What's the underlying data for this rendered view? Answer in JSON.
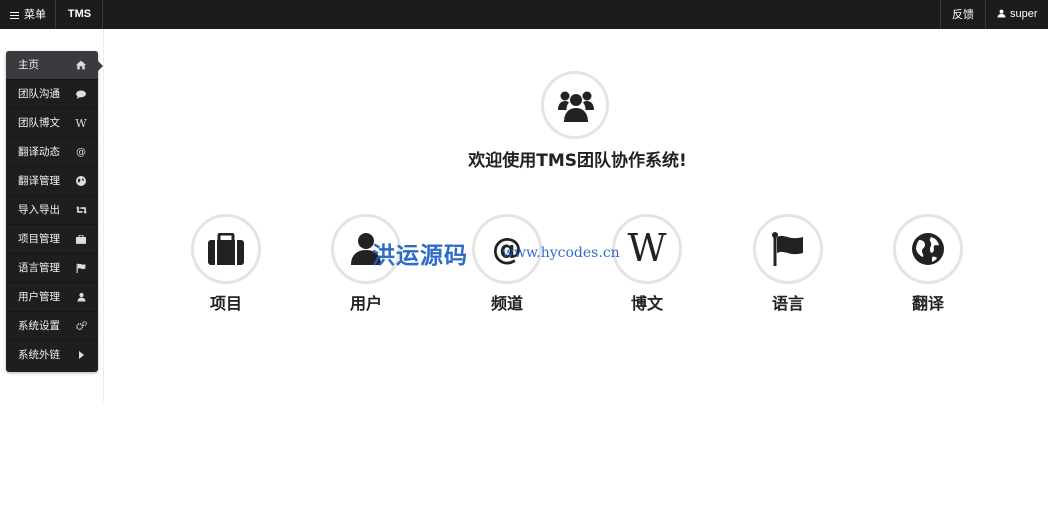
{
  "topbar": {
    "menu_label": "菜单",
    "brand": "TMS",
    "feedback": "反馈",
    "user": "super"
  },
  "sidebar": {
    "items": [
      {
        "label": "主页",
        "icon": "home-icon"
      },
      {
        "label": "团队沟通",
        "icon": "comment-icon"
      },
      {
        "label": "团队博文",
        "icon": "wikipedia-icon"
      },
      {
        "label": "翻译动态",
        "icon": "at-icon"
      },
      {
        "label": "翻译管理",
        "icon": "globe-icon"
      },
      {
        "label": "导入导出",
        "icon": "retweet-icon"
      },
      {
        "label": "项目管理",
        "icon": "briefcase-icon"
      },
      {
        "label": "语言管理",
        "icon": "flag-icon"
      },
      {
        "label": "用户管理",
        "icon": "user-icon"
      },
      {
        "label": "系统设置",
        "icon": "cogs-icon"
      },
      {
        "label": "系统外链",
        "icon": "caret-right-icon"
      }
    ]
  },
  "main": {
    "welcome": "欢迎使用TMS团队协作系统!",
    "tiles": [
      {
        "label": "项目",
        "icon": "briefcase-icon"
      },
      {
        "label": "用户",
        "icon": "user-icon"
      },
      {
        "label": "频道",
        "icon": "at-icon"
      },
      {
        "label": "博文",
        "icon": "wikipedia-icon"
      },
      {
        "label": "语言",
        "icon": "flag-icon"
      },
      {
        "label": "翻译",
        "icon": "globe-icon"
      }
    ]
  },
  "watermark": {
    "text": "洪运源码",
    "url": "www.hycodes.cn"
  },
  "colors": {
    "topbar_bg": "#1b1c1e",
    "sidebar_bg": "#1d1e20",
    "sidebar_active_bg": "#3a3b3e",
    "circle_border": "#e4e4e4",
    "watermark": "#1f5fc4"
  }
}
